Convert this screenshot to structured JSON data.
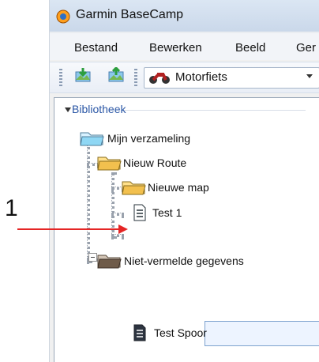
{
  "window": {
    "title": "Garmin BaseCamp"
  },
  "menu": {
    "items": [
      "Bestand",
      "Bewerken",
      "Beeld",
      "Ger"
    ]
  },
  "toolbar": {
    "profile": "Motorfiets"
  },
  "library": {
    "title": "Bibliotheek",
    "nodes": [
      {
        "label": "Mijn verzameling",
        "icon": "folder-icon"
      },
      {
        "label": "Nieuw Route",
        "icon": "folder-open-icon"
      },
      {
        "label": "Nieuwe map",
        "icon": "folder-icon"
      },
      {
        "label": "Test 1",
        "icon": "document-icon"
      },
      {
        "label": "Test Spoor",
        "icon": "document-icon",
        "selected": true
      },
      {
        "label": "Niet-vermelde gegevens",
        "icon": "folder-icon"
      }
    ]
  },
  "annotation": {
    "label": "1"
  }
}
